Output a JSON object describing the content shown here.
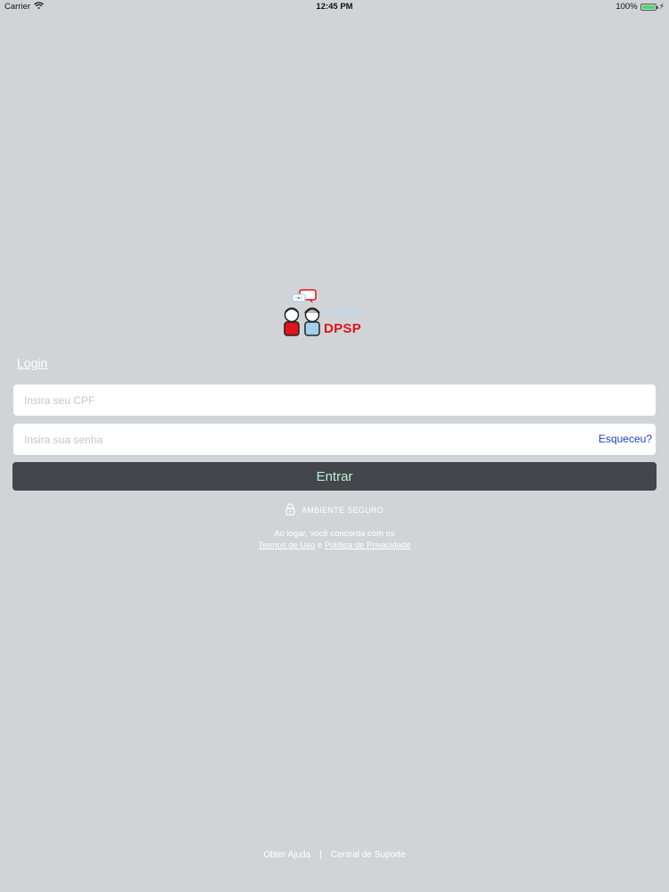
{
  "status_bar": {
    "carrier": "Carrier",
    "time": "12:45 PM",
    "battery": "100%",
    "battery_level": 1.0
  },
  "logo": {
    "brand_text": "DPSP",
    "sub_text": "PORTAL",
    "colors": {
      "red": "#e3131b",
      "light_blue": "#9fd0ee"
    }
  },
  "login": {
    "title": "Login",
    "cpf_placeholder": "Insira seu CPF",
    "password_placeholder": "Insira sua senha",
    "forgot_label": "Esqueceu?",
    "enter_label": "Entrar",
    "secure_label": "AMBIENTE SEGURO",
    "consent_line1": "Ao logar, você concorda com os",
    "terms_label": "Termos de Uso",
    "and_label": "e",
    "privacy_label": "Política de Privacidade"
  },
  "footer": {
    "help_label": "Obter Ajuda",
    "separator": "|",
    "support_label": "Central de Suporte"
  },
  "colors": {
    "background": "#d1d4d7",
    "button": "#43464a",
    "button_text": "#b9f0d5",
    "link": "#1c3fcf"
  },
  "icons": [
    "wifi-icon",
    "battery-icon",
    "charging-icon",
    "lock-icon"
  ]
}
